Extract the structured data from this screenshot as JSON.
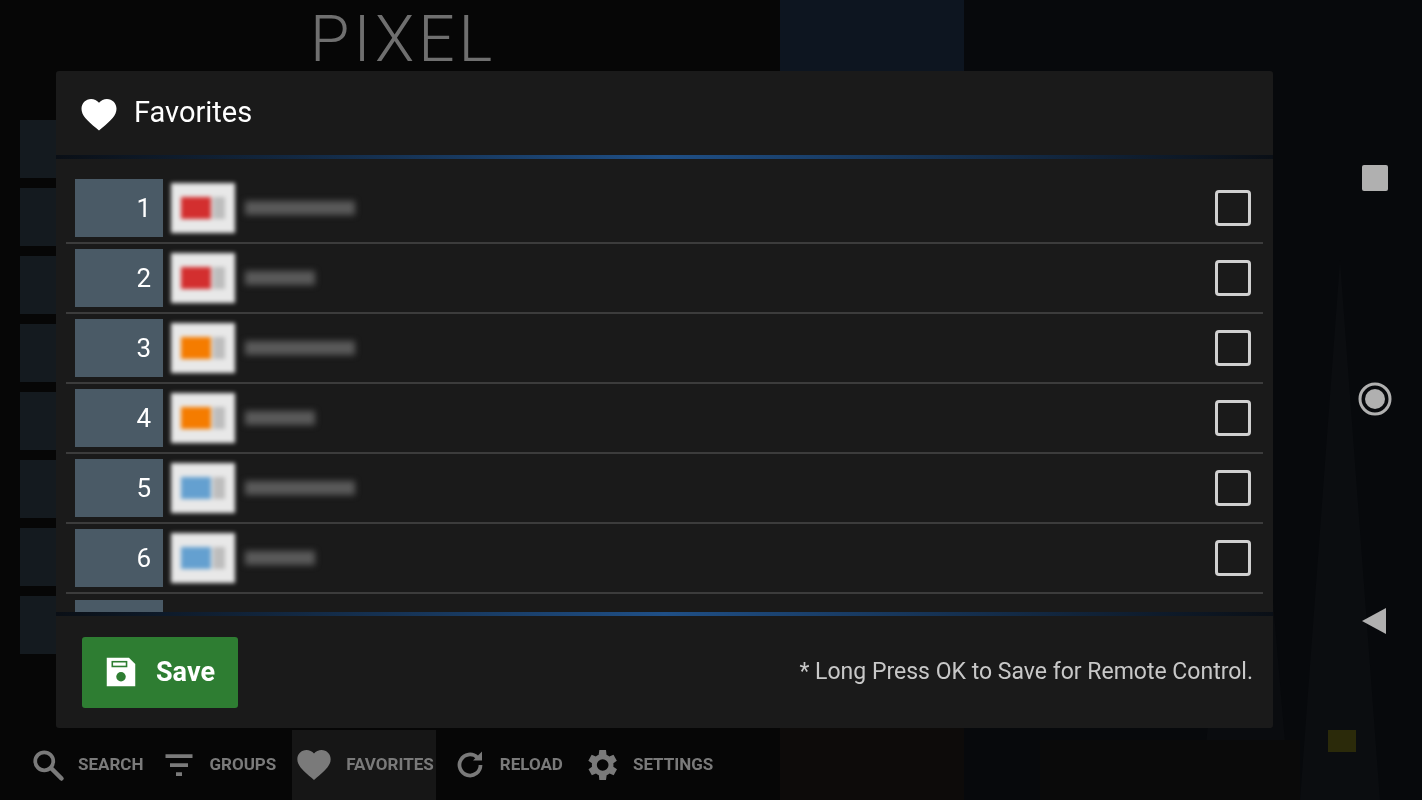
{
  "app": {
    "logo": "PIXEL"
  },
  "bottom_nav": [
    {
      "kind": "search",
      "label": "SEARCH",
      "selected": false
    },
    {
      "kind": "groups",
      "label": "GROUPS",
      "selected": false
    },
    {
      "kind": "favorites",
      "label": "FAVORITES",
      "selected": true
    },
    {
      "kind": "reload",
      "label": "RELOAD",
      "selected": false
    },
    {
      "kind": "settings",
      "label": "SETTINGS",
      "selected": false
    }
  ],
  "dialog": {
    "title": "Favorites",
    "channels": [
      {
        "number": "1",
        "checked": false
      },
      {
        "number": "2",
        "checked": false
      },
      {
        "number": "3",
        "checked": false
      },
      {
        "number": "4",
        "checked": false
      },
      {
        "number": "5",
        "checked": false
      },
      {
        "number": "6",
        "checked": false
      }
    ],
    "save_button": "Save",
    "hint": "* Long Press OK to Save for Remote Control."
  }
}
